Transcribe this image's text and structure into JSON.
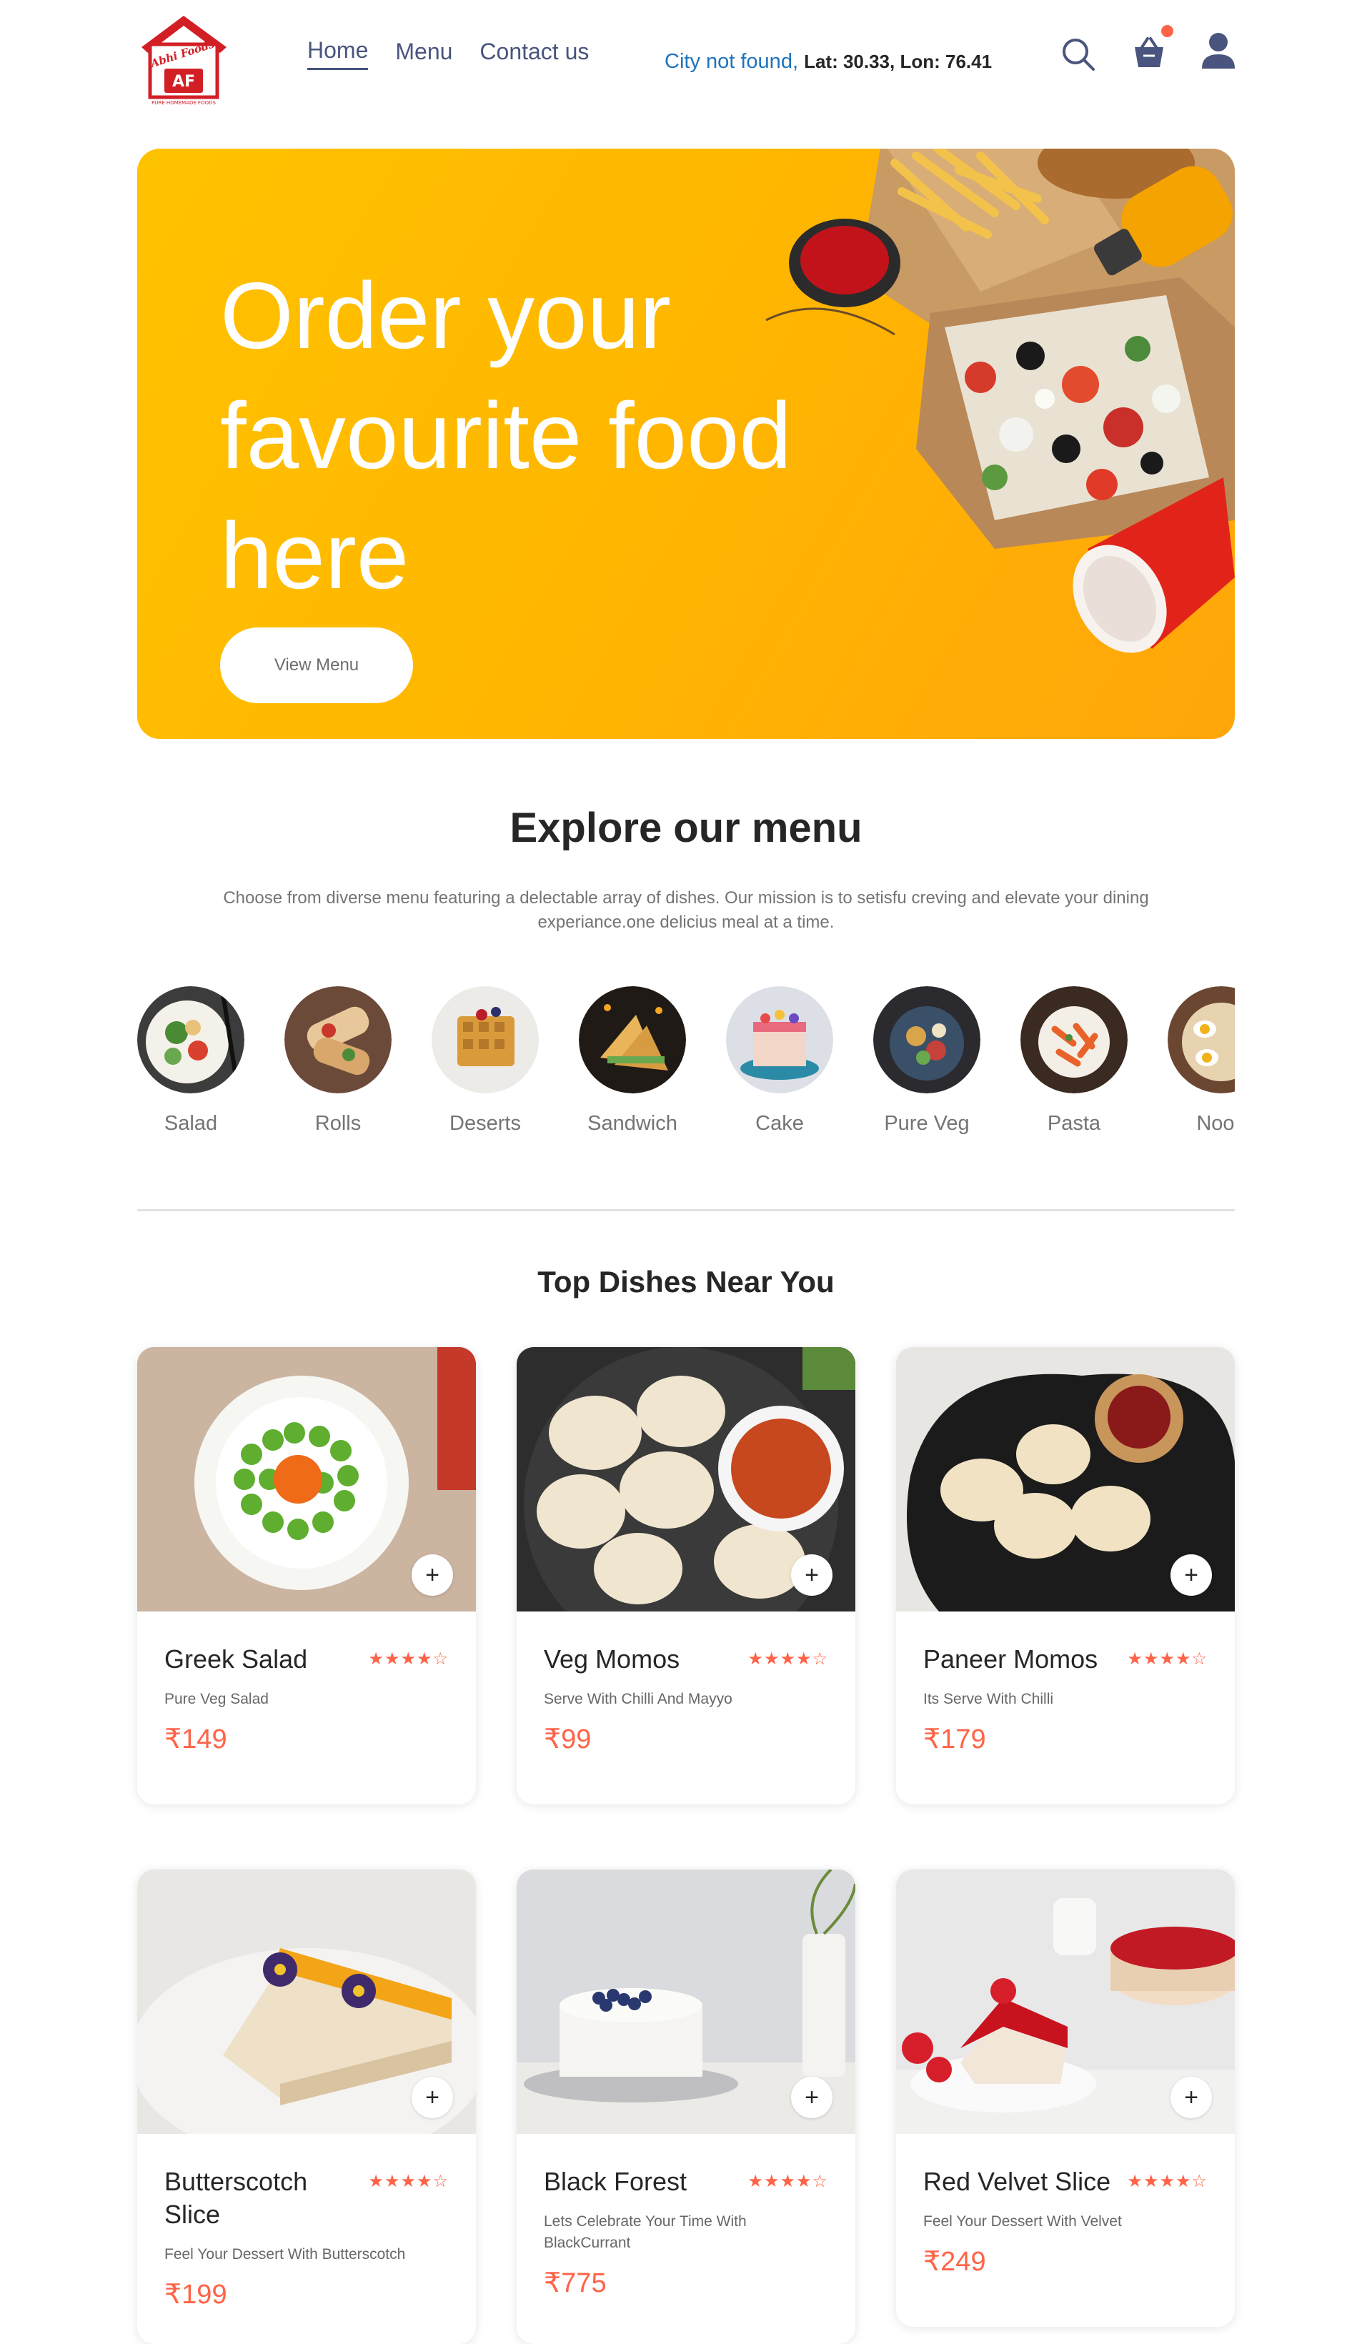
{
  "header": {
    "logo_text": "Abhi Foods",
    "logo_initials": "AF",
    "logo_tagline": "PURE HOMEMADE FOODS",
    "nav": [
      {
        "label": "Home",
        "active": true
      },
      {
        "label": "Menu",
        "active": false
      },
      {
        "label": "Contact us",
        "active": false
      }
    ],
    "location": {
      "city": "City not found,",
      "coords": "Lat: 30.33, Lon: 76.41"
    },
    "icons": [
      "search-icon",
      "basket-icon",
      "user-icon"
    ],
    "accent": "#ff6347"
  },
  "hero": {
    "title": "Order your favourite food here",
    "button_label": "View Menu",
    "background": "#ffb800"
  },
  "explore": {
    "title": "Explore our menu",
    "description": "Choose from diverse menu featuring a delectable array of dishes. Our mission is to setisfu creving and elevate your dining experiance.one delicius meal at a time.",
    "items": [
      {
        "label": "Salad"
      },
      {
        "label": "Rolls"
      },
      {
        "label": "Deserts"
      },
      {
        "label": "Sandwich"
      },
      {
        "label": "Cake"
      },
      {
        "label": "Pure Veg"
      },
      {
        "label": "Pasta"
      },
      {
        "label": "Nood"
      }
    ]
  },
  "dishes": {
    "title": "Top Dishes Near You",
    "items": [
      {
        "name": "Greek Salad",
        "desc": "Pure Veg Salad",
        "price": "₹149",
        "rating": 4
      },
      {
        "name": "Veg Momos",
        "desc": "Serve With Chilli And Mayyo",
        "price": "₹99",
        "rating": 4
      },
      {
        "name": "Paneer Momos",
        "desc": "Its Serve With Chilli",
        "price": "₹179",
        "rating": 4
      },
      {
        "name": "Butterscotch Slice",
        "desc": "Feel Your Dessert With Butterscotch",
        "price": "₹199",
        "rating": 4
      },
      {
        "name": "Black Forest",
        "desc": "Lets Celebrate Your Time With BlackCurrant",
        "price": "₹775",
        "rating": 4
      },
      {
        "name": "Red Velvet Slice",
        "desc": "Feel Your Dessert With Velvet",
        "price": "₹249",
        "rating": 4
      }
    ]
  }
}
